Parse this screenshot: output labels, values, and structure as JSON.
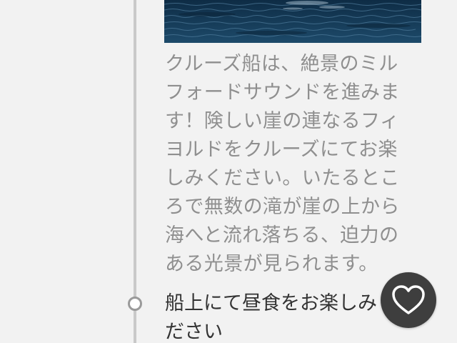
{
  "colors": {
    "background": "#f2f2f2",
    "timeline": "#c9c9c9",
    "description_text": "#8f8f8f",
    "title_text": "#333333",
    "favorite_button": "#3e3e3e"
  },
  "photo": {
    "icon": "sea-water-photo"
  },
  "entry": {
    "description": "クルーズ船は、絶景のミルフォードサウンドを進みます！険しい崖の連なるフィヨルドをクルーズにてお楽しみください。いたるところで無数の滝が崖の上から海へと流れ落ちる、迫力のある光景が見られます。"
  },
  "next_entry": {
    "title": "船上にて昼食をお楽しみください"
  },
  "favorite": {
    "icon": "heart-icon"
  }
}
